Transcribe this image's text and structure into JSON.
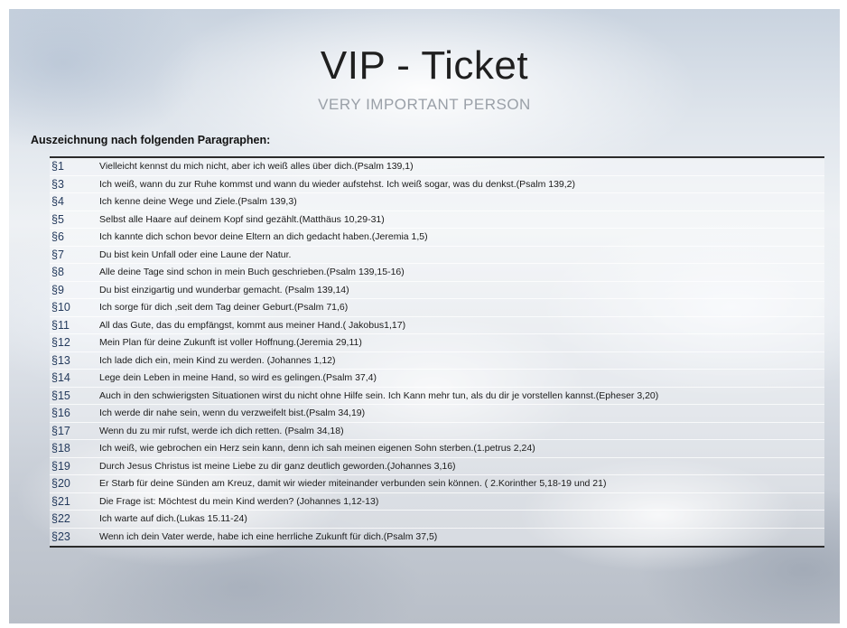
{
  "title": "VIP - Ticket",
  "subtitle": "VERY IMPORTANT PERSON",
  "heading": "Auszeichnung nach folgenden Paragraphen:",
  "rows": [
    {
      "num": "§1",
      "text": "Vielleicht kennst du mich nicht, aber ich weiß alles über dich.(Psalm 139,1)"
    },
    {
      "num": "§3",
      "text": "Ich weiß, wann du zur Ruhe kommst und wann du wieder aufstehst. Ich weiß sogar, was du denkst.(Psalm 139,2)"
    },
    {
      "num": "§4",
      "text": "Ich kenne deine Wege und Ziele.(Psalm 139,3)"
    },
    {
      "num": "§5",
      "text": "Selbst alle Haare auf deinem Kopf sind gezählt.(Matthäus 10,29-31)"
    },
    {
      "num": "§6",
      "text": "Ich kannte dich schon bevor deine Eltern an dich gedacht haben.(Jeremia 1,5)"
    },
    {
      "num": "§7",
      "text": "Du bist kein Unfall oder eine Laune der Natur."
    },
    {
      "num": "§8",
      "text": "Alle deine Tage sind schon in mein Buch geschrieben.(Psalm 139,15-16)"
    },
    {
      "num": "§9",
      "text": "Du bist einzigartig und wunderbar gemacht. (Psalm 139,14)"
    },
    {
      "num": "§10",
      "text": "Ich sorge für dich ,seit dem Tag deiner Geburt.(Psalm 71,6)"
    },
    {
      "num": "§11",
      "text": "All das Gute, das du empfängst, kommt aus meiner Hand.( Jakobus1,17)"
    },
    {
      "num": "§12",
      "text": "Mein Plan für deine Zukunft ist voller Hoffnung.(Jeremia 29,11)"
    },
    {
      "num": "§13",
      "text": "Ich lade dich ein, mein Kind zu werden. (Johannes 1,12)"
    },
    {
      "num": "§14",
      "text": "Lege dein Leben in meine Hand, so wird es gelingen.(Psalm 37,4)"
    },
    {
      "num": "§15",
      "text": "Auch in den schwierigsten Situationen wirst du nicht ohne Hilfe sein. Ich Kann mehr tun, als du dir je vorstellen kannst.(Epheser 3,20)"
    },
    {
      "num": "§16",
      "text": "Ich werde dir nahe sein, wenn du verzweifelt bist.(Psalm 34,19)"
    },
    {
      "num": "§17",
      "text": "Wenn du zu mir rufst, werde ich dich retten. (Psalm 34,18)"
    },
    {
      "num": "§18",
      "text": "Ich weiß, wie gebrochen ein Herz sein kann, denn ich sah meinen eigenen Sohn sterben.(1.petrus 2,24)"
    },
    {
      "num": "§19",
      "text": "Durch Jesus Christus ist meine Liebe zu dir ganz deutlich geworden.(Johannes 3,16)"
    },
    {
      "num": "§20",
      "text": "Er Starb für deine Sünden am Kreuz, damit wir wieder miteinander verbunden sein können. ( 2.Korinther 5,18-19 und 21)"
    },
    {
      "num": "§21",
      "text": "Die Frage ist:  Möchtest du mein Kind werden? (Johannes 1,12-13)"
    },
    {
      "num": "§22",
      "text": "Ich warte auf dich.(Lukas 15.11-24)"
    },
    {
      "num": "§23",
      "text": "Wenn ich dein Vater werde, habe ich eine herrliche Zukunft für dich.(Psalm 37,5)"
    }
  ]
}
